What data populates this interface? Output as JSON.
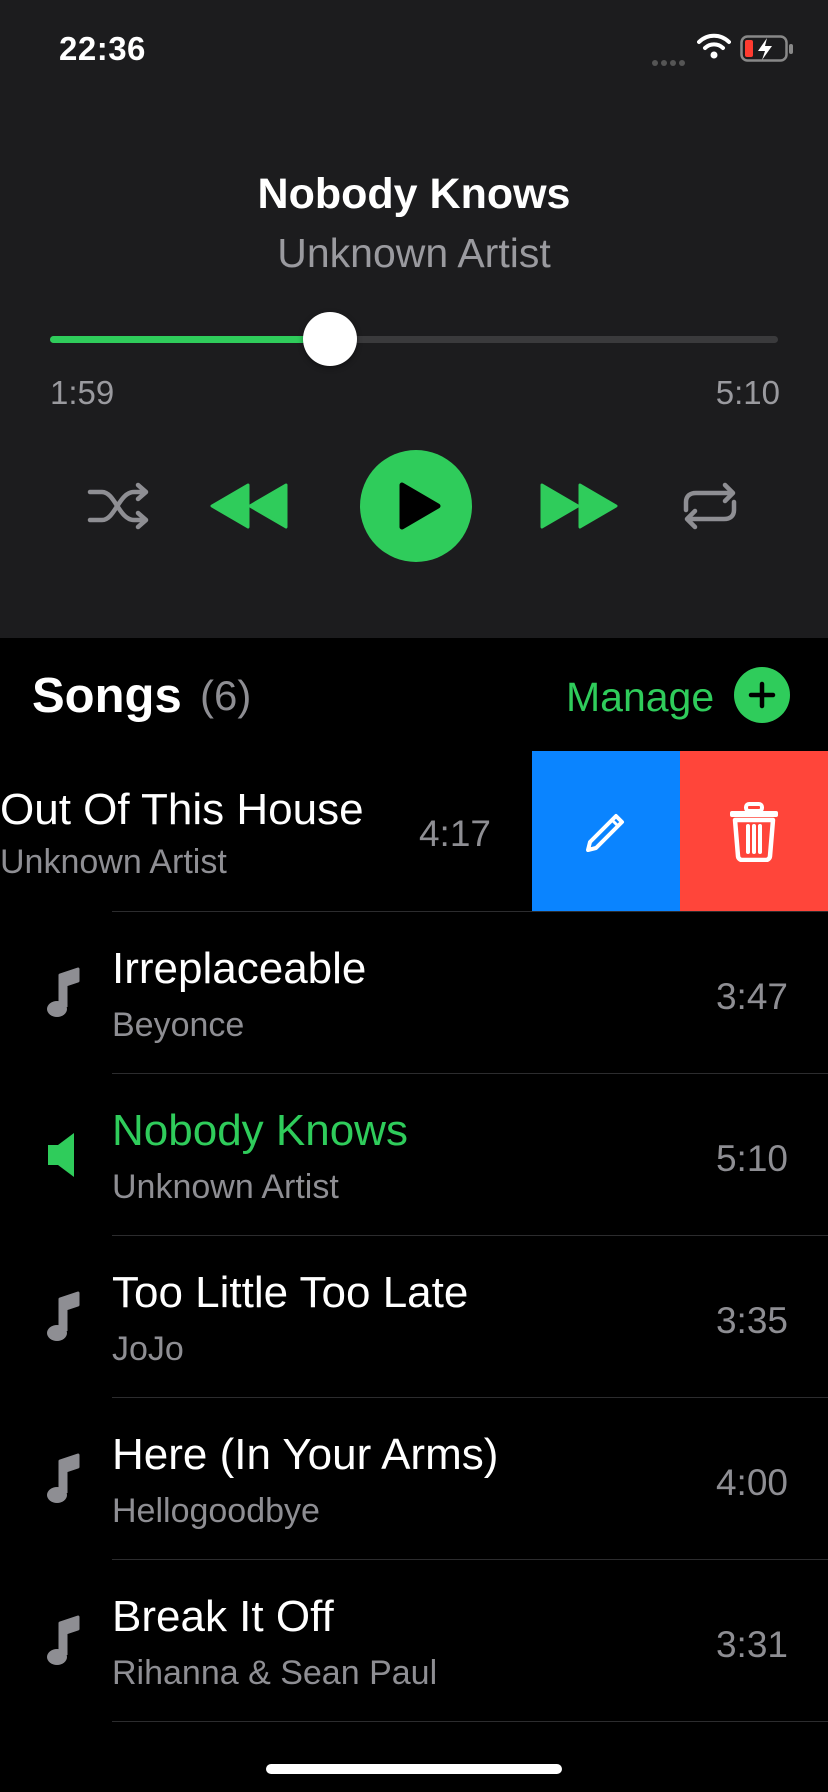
{
  "status_bar": {
    "time": "22:36",
    "icons": [
      "cellular-dots-icon",
      "wifi-icon",
      "battery-charging-icon"
    ]
  },
  "now_playing": {
    "title": "Nobody Knows",
    "artist": "Unknown Artist",
    "elapsed": "1:59",
    "duration": "5:10",
    "progress_fraction": 0.384,
    "controls": [
      "shuffle-icon",
      "rewind-icon",
      "play-icon",
      "fast-forward-icon",
      "repeat-icon"
    ]
  },
  "songs": {
    "title": "Songs",
    "count": "(6)",
    "manage_label": "Manage",
    "add_icon": "plus-icon",
    "swiped": {
      "title": "Out Of This House",
      "artist": "Unknown Artist",
      "duration": "4:17",
      "actions": [
        "pencil-icon",
        "trash-icon"
      ]
    },
    "items": [
      {
        "title": "Irreplaceable",
        "artist": "Beyonce",
        "duration": "3:47",
        "icon": "music-note-icon",
        "playing": false
      },
      {
        "title": "Nobody Knows",
        "artist": "Unknown Artist",
        "duration": "5:10",
        "icon": "speaker-icon",
        "playing": true
      },
      {
        "title": "Too Little Too Late",
        "artist": "JoJo",
        "duration": "3:35",
        "icon": "music-note-icon",
        "playing": false
      },
      {
        "title": "Here (In Your Arms)",
        "artist": "Hellogoodbye",
        "duration": "4:00",
        "icon": "music-note-icon",
        "playing": false
      },
      {
        "title": "Break It Off",
        "artist": "Rihanna & Sean Paul",
        "duration": "3:31",
        "icon": "music-note-icon",
        "playing": false
      }
    ]
  },
  "colors": {
    "accent": "#2fcc5b",
    "edit": "#0a84ff",
    "delete": "#ff453a",
    "panel": "#1c1c1e"
  }
}
